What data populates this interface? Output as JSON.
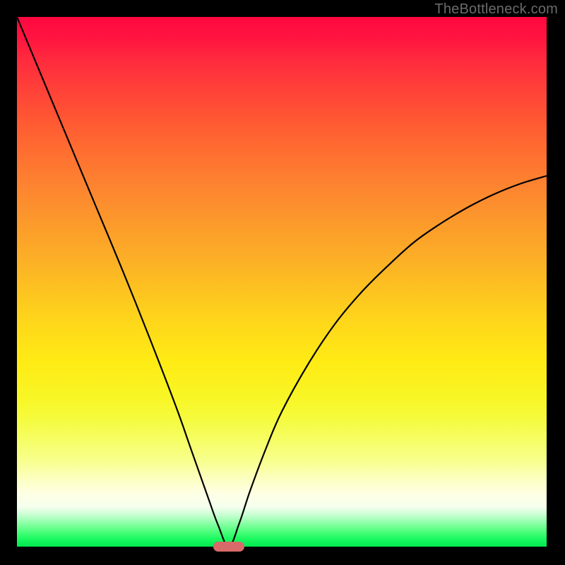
{
  "watermark": "TheBottleneck.com",
  "chart_data": {
    "type": "line",
    "title": "",
    "xlabel": "",
    "ylabel": "",
    "xlim": [
      0,
      1
    ],
    "ylim": [
      0,
      1
    ],
    "series": [
      {
        "name": "bottleneck-curve",
        "x": [
          0.0,
          0.05,
          0.1,
          0.15,
          0.2,
          0.25,
          0.3,
          0.33,
          0.36,
          0.38,
          0.4,
          0.42,
          0.44,
          0.47,
          0.5,
          0.55,
          0.6,
          0.65,
          0.7,
          0.75,
          0.8,
          0.85,
          0.9,
          0.95,
          1.0
        ],
        "values": [
          1.0,
          0.88,
          0.76,
          0.64,
          0.52,
          0.395,
          0.265,
          0.18,
          0.095,
          0.04,
          0.0,
          0.045,
          0.105,
          0.185,
          0.255,
          0.345,
          0.42,
          0.48,
          0.53,
          0.575,
          0.61,
          0.64,
          0.665,
          0.685,
          0.7
        ]
      }
    ],
    "annotations": [
      {
        "name": "bottleneck-marker",
        "x": 0.4,
        "y": 0.0,
        "color": "#d86a6a"
      }
    ],
    "background_gradient": {
      "top": "#ff0740",
      "middle": "#ffe014",
      "bottom": "#00e850"
    }
  }
}
